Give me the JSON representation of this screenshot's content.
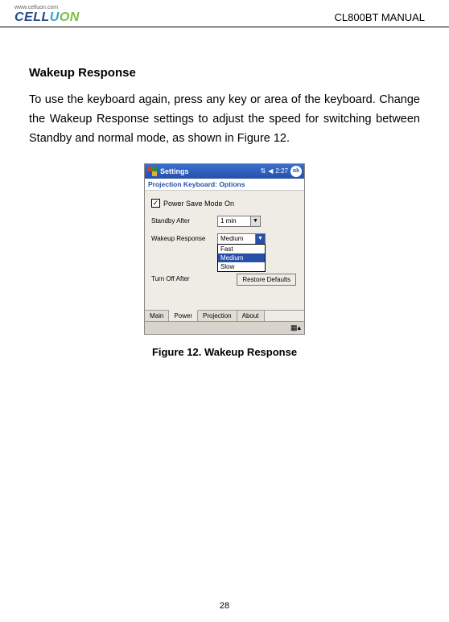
{
  "header": {
    "logo_url": "www.celluon.com",
    "logo_brand": "CELLUON",
    "manual": "CL800BT MANUAL"
  },
  "section": {
    "title": "Wakeup Response",
    "body": "To use the keyboard again, press any key or area of the keyboard. Change the Wakeup Response settings to adjust the speed for switching between Standby and normal mode, as shown in Figure 12."
  },
  "screen": {
    "titlebar": "Settings",
    "time": "2:27",
    "ok": "ok",
    "subtitle": "Projection Keyboard: Options",
    "checkbox_label": "Power Save Mode On",
    "rows": {
      "standby": {
        "label": "Standby After",
        "value": "1 min"
      },
      "wakeup": {
        "label": "Wakeup Response",
        "value": "Medium"
      },
      "turnoff": {
        "label": "Turn Off After"
      }
    },
    "dropdown": {
      "opt_fast": "Fast",
      "opt_medium": "Medium",
      "opt_slow": "Slow"
    },
    "restore": "Restore Defaults",
    "tabs": {
      "main": "Main",
      "power": "Power",
      "projection": "Projection",
      "about": "About"
    }
  },
  "caption": "Figure 12. Wakeup Response",
  "page": "28"
}
